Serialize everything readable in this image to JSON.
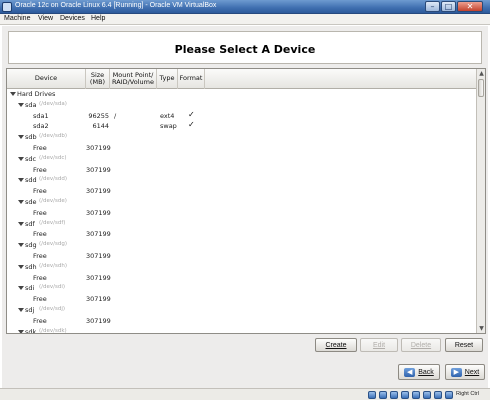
{
  "window": {
    "title": "Oracle 12c on Oracle Linux 6.4 [Running] - Oracle VM VirtualBox"
  },
  "menubar": {
    "items": [
      "Machine",
      "View",
      "Devices",
      "Help"
    ]
  },
  "installer": {
    "heading": "Please Select A Device"
  },
  "table": {
    "columns": [
      "Device",
      "Size\n(MB)",
      "Mount Point/\nRAID/Volume",
      "Type",
      "Format"
    ],
    "group": "Hard Drives",
    "rows": [
      {
        "kind": "disk",
        "device": "sda",
        "path": "(/dev/sda)"
      },
      {
        "kind": "part",
        "device": "sda1",
        "size": "96255",
        "mount": "/",
        "type": "ext4",
        "format": "✓"
      },
      {
        "kind": "part",
        "device": "sda2",
        "size": "6144",
        "mount": "",
        "type": "swap",
        "format": "✓"
      },
      {
        "kind": "disk",
        "device": "sdb",
        "path": "(/dev/sdb)"
      },
      {
        "kind": "part",
        "device": "Free",
        "size": "307199",
        "mount": "",
        "type": "",
        "format": ""
      },
      {
        "kind": "disk",
        "device": "sdc",
        "path": "(/dev/sdc)"
      },
      {
        "kind": "part",
        "device": "Free",
        "size": "307199",
        "mount": "",
        "type": "",
        "format": ""
      },
      {
        "kind": "disk",
        "device": "sdd",
        "path": "(/dev/sdd)"
      },
      {
        "kind": "part",
        "device": "Free",
        "size": "307199",
        "mount": "",
        "type": "",
        "format": ""
      },
      {
        "kind": "disk",
        "device": "sde",
        "path": "(/dev/sde)"
      },
      {
        "kind": "part",
        "device": "Free",
        "size": "307199",
        "mount": "",
        "type": "",
        "format": ""
      },
      {
        "kind": "disk",
        "device": "sdf",
        "path": "(/dev/sdf)"
      },
      {
        "kind": "part",
        "device": "Free",
        "size": "307199",
        "mount": "",
        "type": "",
        "format": ""
      },
      {
        "kind": "disk",
        "device": "sdg",
        "path": "(/dev/sdg)"
      },
      {
        "kind": "part",
        "device": "Free",
        "size": "307199",
        "mount": "",
        "type": "",
        "format": ""
      },
      {
        "kind": "disk",
        "device": "sdh",
        "path": "(/dev/sdh)"
      },
      {
        "kind": "part",
        "device": "Free",
        "size": "307199",
        "mount": "",
        "type": "",
        "format": ""
      },
      {
        "kind": "disk",
        "device": "sdi",
        "path": "(/dev/sdi)"
      },
      {
        "kind": "part",
        "device": "Free",
        "size": "307199",
        "mount": "",
        "type": "",
        "format": ""
      },
      {
        "kind": "disk",
        "device": "sdj",
        "path": "(/dev/sdj)"
      },
      {
        "kind": "part",
        "device": "Free",
        "size": "307199",
        "mount": "",
        "type": "",
        "format": ""
      },
      {
        "kind": "disk",
        "device": "sdk",
        "path": "(/dev/sdk)"
      }
    ]
  },
  "actions": {
    "create": "Create",
    "edit": "Edit",
    "delete": "Delete",
    "reset": "Reset"
  },
  "nav": {
    "back": "Back",
    "next": "Next"
  },
  "statusbar": {
    "host_key": "Right Ctrl"
  }
}
